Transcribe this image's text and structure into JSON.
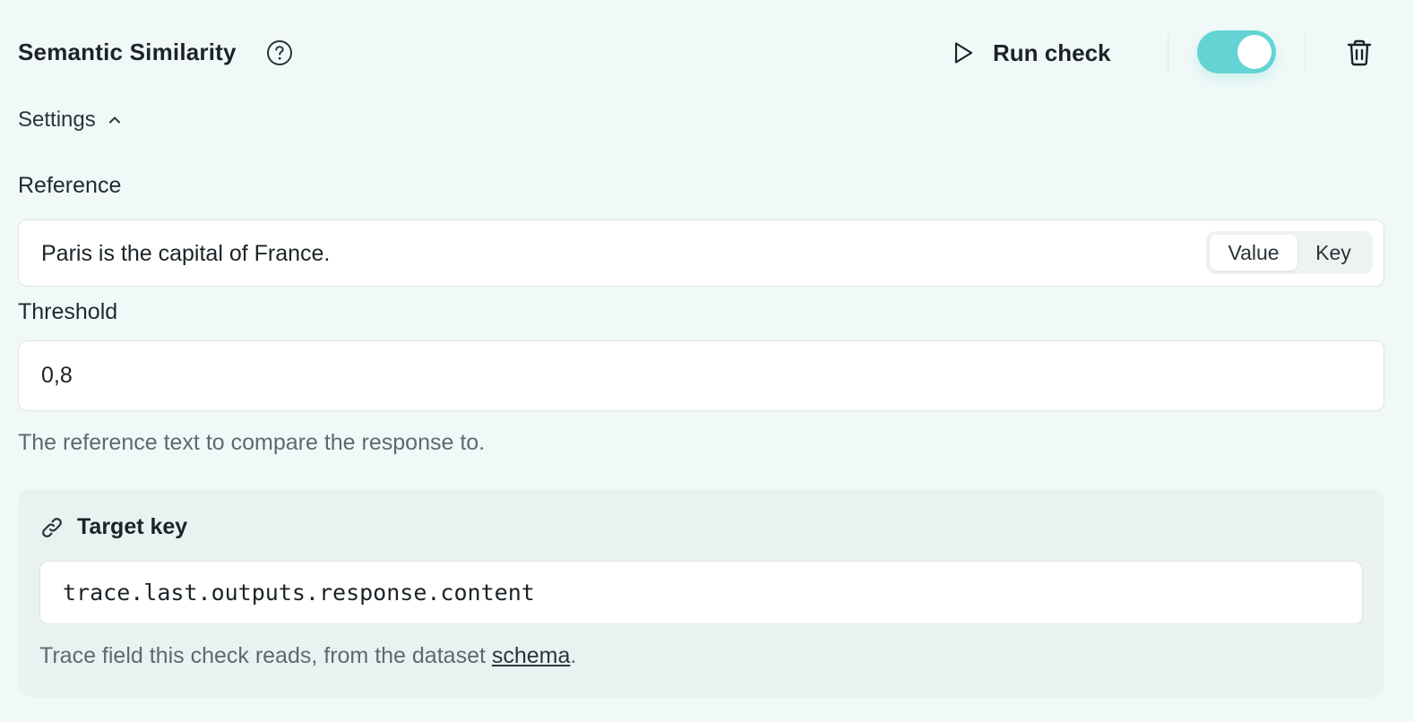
{
  "header": {
    "title": "Semantic Similarity",
    "run_check_label": "Run check",
    "toggle_enabled": true
  },
  "settings": {
    "label": "Settings",
    "expanded": true
  },
  "reference": {
    "label": "Reference",
    "value": "Paris is the capital of France.",
    "mode_options": [
      "Value",
      "Key"
    ],
    "selected_mode": "Value"
  },
  "threshold": {
    "label": "Threshold",
    "value": "0,8"
  },
  "hint": "The reference text to compare the response to.",
  "target_key": {
    "title": "Target key",
    "value": "trace.last.outputs.response.content",
    "hint_prefix": "Trace field this check reads, from the dataset ",
    "hint_link": "schema",
    "hint_suffix": "."
  },
  "colors": {
    "background": "#f1f9f8",
    "toggle_on": "#63d3d3",
    "card": "#e9f2f1"
  },
  "icons": [
    "help-circle-icon",
    "play-icon",
    "trash-icon",
    "chevron-up-icon",
    "link-icon"
  ]
}
